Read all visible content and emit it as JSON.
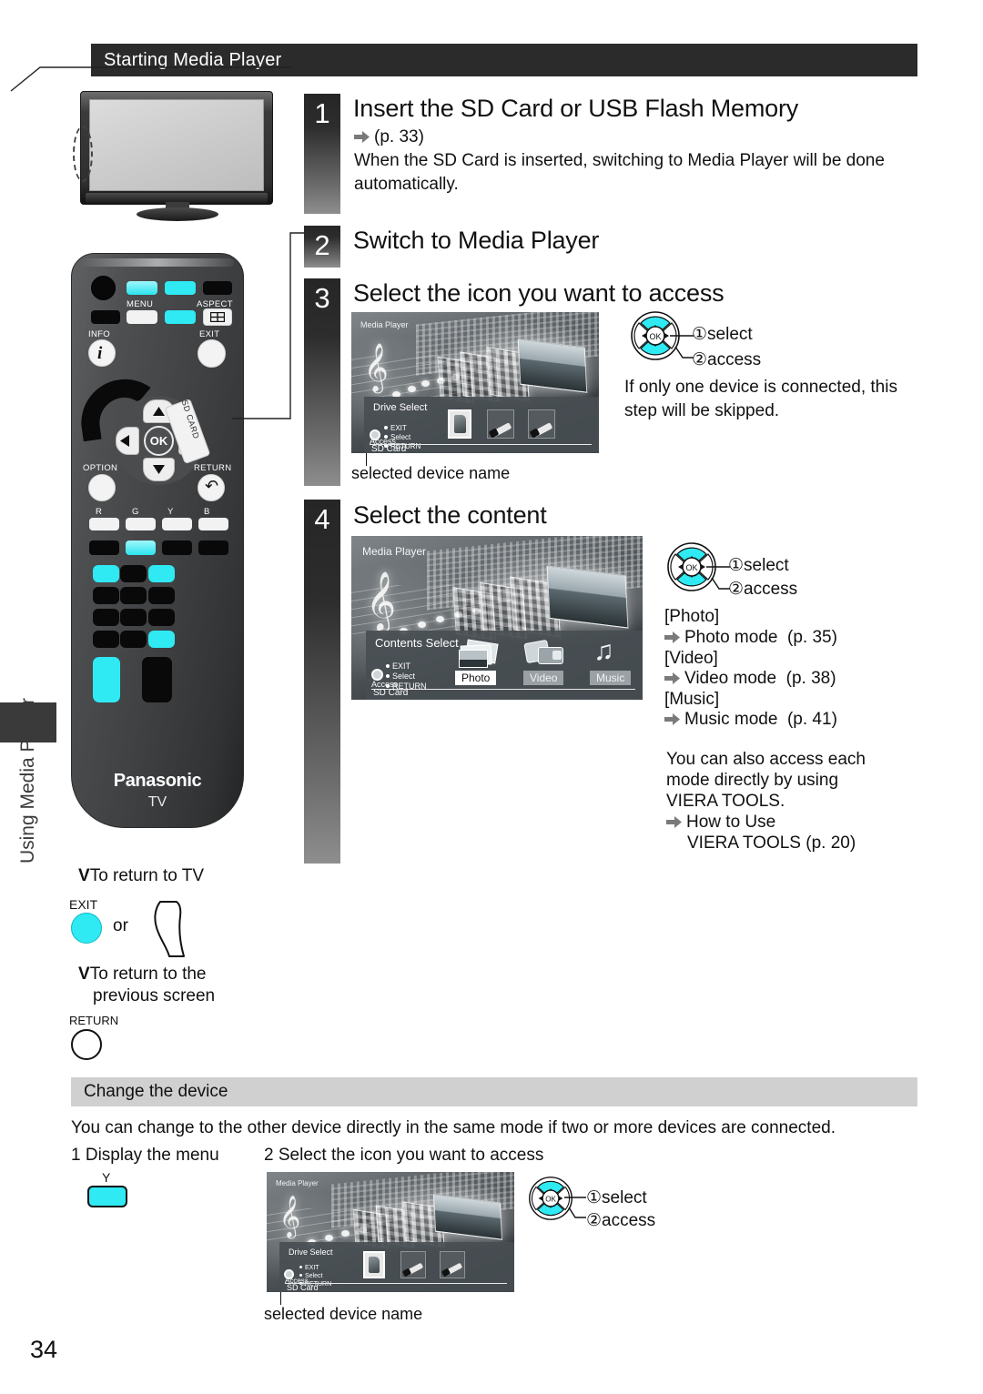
{
  "page": {
    "number": "34",
    "section_header": "Starting Media Player",
    "side_tab_label": "Using Media Player"
  },
  "steps": [
    {
      "num": "1",
      "title": "Insert the SD Card or USB Flash Memory",
      "ref": "(p. 33)",
      "body": "When the SD Card is inserted, switching to Media Player will be done automatically."
    },
    {
      "num": "2",
      "title": "Switch to Media Player"
    },
    {
      "num": "3",
      "title": "Select the icon you want to access",
      "note": "If only one device is connected, this step will be skipped.",
      "caption": "selected device name"
    },
    {
      "num": "4",
      "title": "Select the content"
    }
  ],
  "dpad": {
    "ok_label": "OK",
    "select_label": "select",
    "access_label": "access",
    "select_num": "①",
    "access_num": "②"
  },
  "drive_select_screen": {
    "app_title": "Media Player",
    "panel_title": "Drive Select",
    "key_exit": "EXIT",
    "key_select": "Select",
    "key_return": "RETURN",
    "access_label": "Access",
    "device_label": "SD Card"
  },
  "contents_select_screen": {
    "app_title": "Media Player",
    "panel_title": "Contents Select",
    "key_exit": "EXIT",
    "key_select": "Select",
    "key_return": "RETURN",
    "access_label": "Access",
    "device_label": "SD Card",
    "chips": [
      "Photo",
      "Video",
      "Music"
    ]
  },
  "modes": [
    {
      "bracket": "[Photo]",
      "mode": "Photo mode",
      "page": "(p. 35)"
    },
    {
      "bracket": "[Video]",
      "mode": "Video mode",
      "page": "(p. 38)"
    },
    {
      "bracket": "[Music]",
      "mode": "Music mode",
      "page": "(p. 41)"
    }
  ],
  "viera_tools": {
    "line1": "You can also access each",
    "line2": "mode directly by using",
    "line3": "VIERA TOOLS.",
    "link1": "How to Use",
    "link2": "VIERA TOOLS  (p. 20)"
  },
  "return_block": {
    "to_tv_mark": "V",
    "to_tv": "To return to TV",
    "exit_label": "EXIT",
    "or_label": "or",
    "to_prev_mark": "V",
    "to_prev_line1": "To return to the",
    "to_prev_line2": "previous screen",
    "return_label": "RETURN"
  },
  "change_device": {
    "heading": "Change the device",
    "intro": "You can change to the other device directly in the same mode if two or more devices are connected.",
    "step1_num": "1",
    "step1_label": "Display the menu",
    "step2_num": "2",
    "step2_label": "Select the icon you want to access",
    "y_button_label": "Y",
    "caption": "selected device name"
  },
  "remote": {
    "brand": "Panasonic",
    "brand_sub": "TV",
    "labels": {
      "menu": "MENU",
      "aspect": "ASPECT",
      "info": "INFO",
      "exit": "EXIT",
      "option": "OPTION",
      "return": "RETURN",
      "sd_card": "SD CARD",
      "r": "R",
      "g": "G",
      "y": "Y",
      "b": "B"
    }
  },
  "colors": {
    "header_bg": "#2b2b2b",
    "subbar_bg": "#d0d0d0",
    "cyan": "#2fe9f3",
    "arrow_gray": "#7a7a7a"
  }
}
